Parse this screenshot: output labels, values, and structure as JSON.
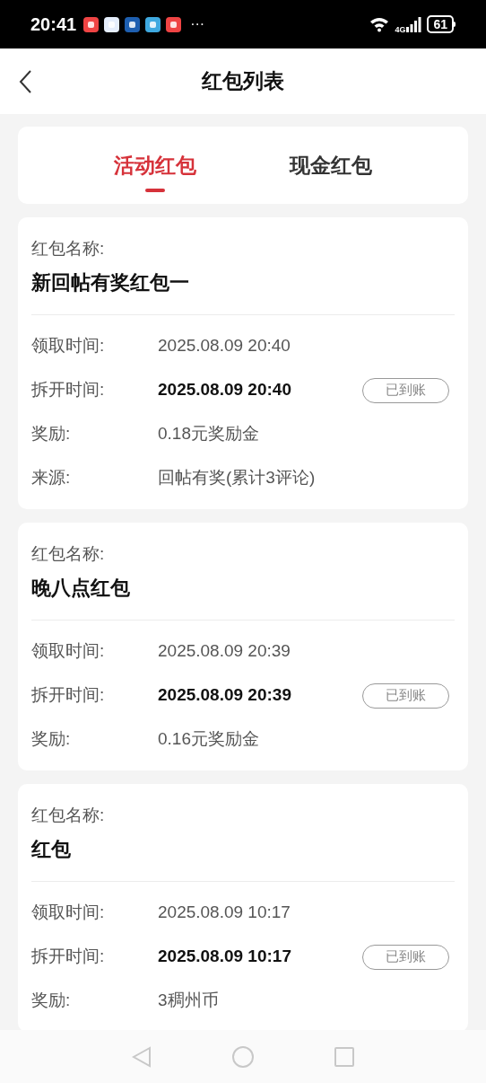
{
  "status_bar": {
    "time": "20:41",
    "more": "···",
    "network": "4G",
    "battery": "61"
  },
  "header": {
    "title": "红包列表"
  },
  "tabs": [
    {
      "label": "活动红包",
      "selected": true
    },
    {
      "label": "现金红包",
      "selected": false
    }
  ],
  "cards": [
    {
      "name_label": "红包名称:",
      "name": "新回帖有奖红包一",
      "rows": [
        {
          "label": "领取时间:",
          "value": "2025.08.09 20:40",
          "emphasized": false
        },
        {
          "label": "拆开时间:",
          "value": "2025.08.09 20:40",
          "emphasized": true,
          "badge": "已到账"
        },
        {
          "label": "奖励:",
          "value": "0.18元奖励金",
          "emphasized": false
        },
        {
          "label": "来源:",
          "value": "回帖有奖(累计3评论)",
          "emphasized": false
        }
      ]
    },
    {
      "name_label": "红包名称:",
      "name": "晚八点红包",
      "rows": [
        {
          "label": "领取时间:",
          "value": "2025.08.09 20:39",
          "emphasized": false
        },
        {
          "label": "拆开时间:",
          "value": "2025.08.09 20:39",
          "emphasized": true,
          "badge": "已到账"
        },
        {
          "label": "奖励:",
          "value": "0.16元奖励金",
          "emphasized": false
        }
      ]
    },
    {
      "name_label": "红包名称:",
      "name": "红包",
      "rows": [
        {
          "label": "领取时间:",
          "value": "2025.08.09 10:17",
          "emphasized": false
        },
        {
          "label": "拆开时间:",
          "value": "2025.08.09 10:17",
          "emphasized": true,
          "badge": "已到账"
        },
        {
          "label": "奖励:",
          "value": "3稠州币",
          "emphasized": false
        }
      ]
    }
  ]
}
